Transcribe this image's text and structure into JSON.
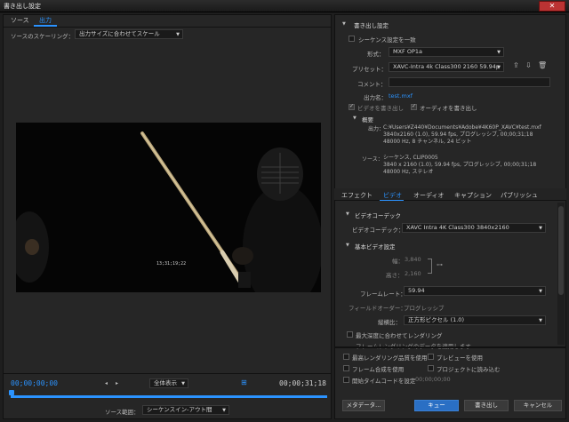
{
  "window": {
    "title": "書き出し設定",
    "close_label": "✕"
  },
  "left": {
    "tabs": [
      {
        "label": "ソース"
      },
      {
        "label": "出力"
      }
    ],
    "scaling_label": "ソースのスケーリング：",
    "scaling_value": "出力サイズに合わせてスケール",
    "overlay_timecode": "13;31;19;22",
    "timecode_in": "00;00;00;00",
    "timecode_out": "00;00;31;18",
    "zoom_value": "全体表示",
    "range_label": "ソース範囲：",
    "range_value": "シーケンスイン-アウト間"
  },
  "export": {
    "header": "書き出し設定",
    "match_sequence": "シーケンス設定を一致",
    "format_label": "形式：",
    "format_value": "MXF OP1a",
    "preset_label": "プリセット：",
    "preset_value": "XAVC-Intra 4k Class300 2160 59.94p",
    "comment_label": "コメント：",
    "output_name_label": "出力名：",
    "output_name_value": "test.mxf",
    "export_video": "ビデオを書き出し",
    "export_audio": "オーディオを書き出し",
    "summary_header": "概要",
    "output_label": "出力：",
    "output_lines": [
      "C:¥Users¥Z440¥Documents¥Adobe¥4K60P_XAVC¥test.mxf",
      "3840x2160 (1.0), 59.94 fps, プログレッシブ, 00;00;31;18",
      "48000 Hz, 8 チャンネル, 24 ビット"
    ],
    "source_label": "ソース：",
    "source_lines": [
      "シーケンス, CLIP0005",
      "3840 x 2160 (1.0), 59.94 fps, プログレッシブ, 00;00;31;18",
      "48000 Hz, ステレオ"
    ]
  },
  "subtabs": [
    {
      "label": "エフェクト"
    },
    {
      "label": "ビデオ"
    },
    {
      "label": "オーディオ"
    },
    {
      "label": "キャプション"
    },
    {
      "label": "パブリッシュ"
    }
  ],
  "video": {
    "codec_header": "ビデオコーデック",
    "codec_label": "ビデオコーデック：",
    "codec_value": "XAVC Intra 4K Class300 3840x2160",
    "basic_header": "基本ビデオ設定",
    "width_label": "幅：",
    "width_value": "3,840",
    "height_label": "高さ：",
    "height_value": "2,160",
    "framerate_label": "フレームレート：",
    "framerate_value": "59.94",
    "field_label": "フィールドオーダー：",
    "field_value": "プログレッシブ",
    "aspect_label": "縦横比：",
    "aspect_value": "正方形ピクセル (1.0)",
    "max_depth": "最大深度に合わせてレンダリング",
    "cut_text": "フレームレンダリングのデータを適用します"
  },
  "options": {
    "max_quality": "最高レンダリング品質を使用",
    "use_preview": "プレビューを使用",
    "frame_blend": "フレーム合成を使用",
    "import_project": "プロジェクトに読み込む",
    "start_tc_label": "開始タイムコードを設定",
    "start_tc_value": "00;00;00;00"
  },
  "buttons": {
    "metadata": "メタデータ...",
    "queue": "キュー",
    "export": "書き出し",
    "cancel": "キャンセル"
  },
  "colors": {
    "accent": "#2b93ff"
  }
}
